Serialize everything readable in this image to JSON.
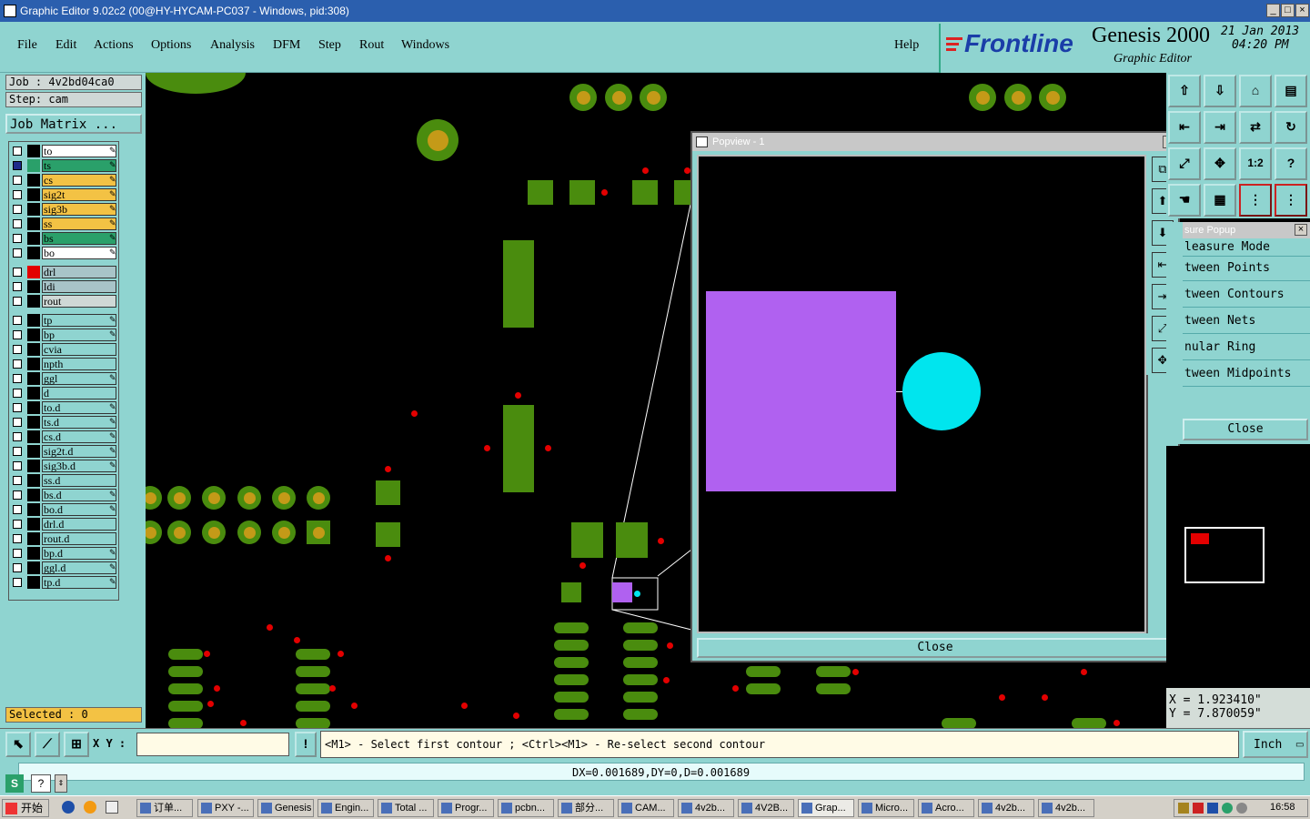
{
  "window": {
    "title": "Graphic Editor 9.02c2 (00@HY-HYCAM-PC037 - Windows, pid:308)"
  },
  "menu": [
    "File",
    "Edit",
    "Actions",
    "Options",
    "Analysis",
    "DFM",
    "Step",
    "Rout",
    "Windows"
  ],
  "help_label": "Help",
  "brand": {
    "logo": "Frontline",
    "product": "Genesis 2000",
    "subtitle": "Graphic Editor",
    "date": "21 Jan 2013",
    "time": "04:20 PM"
  },
  "job": {
    "job_label": "Job  :  4v2bd04ca0",
    "step_label": "Step:  cam",
    "matrix_button": "Job Matrix ..."
  },
  "layers": [
    {
      "name": "to",
      "color": "#ffffff"
    },
    {
      "name": "ts",
      "color": "#2aa06a"
    },
    {
      "name": "cs",
      "color": "#f3c244"
    },
    {
      "name": "sig2t",
      "color": "#f3c244"
    },
    {
      "name": "sig3b",
      "color": "#f3c244"
    },
    {
      "name": "ss",
      "color": "#f3c244"
    },
    {
      "name": "bs",
      "color": "#2aa06a"
    },
    {
      "name": "bo",
      "color": "#ffffff"
    },
    {
      "name": "drl",
      "color": "#a8c4c8"
    },
    {
      "name": "ldi",
      "color": "#a8c4c8"
    },
    {
      "name": "rout",
      "color": "#cfd8d6"
    },
    {
      "name": "tp",
      "color": "#8fd4d0"
    },
    {
      "name": "bp",
      "color": "#8fd4d0"
    },
    {
      "name": "cvia",
      "color": "#8fd4d0"
    },
    {
      "name": "npth",
      "color": "#8fd4d0"
    },
    {
      "name": "ggl",
      "color": "#8fd4d0"
    },
    {
      "name": "d",
      "color": "#8fd4d0"
    },
    {
      "name": "to.d",
      "color": "#8fd4d0"
    },
    {
      "name": "ts.d",
      "color": "#8fd4d0"
    },
    {
      "name": "cs.d",
      "color": "#8fd4d0"
    },
    {
      "name": "sig2t.d",
      "color": "#8fd4d0"
    },
    {
      "name": "sig3b.d",
      "color": "#8fd4d0"
    },
    {
      "name": "ss.d",
      "color": "#8fd4d0"
    },
    {
      "name": "bs.d",
      "color": "#8fd4d0"
    },
    {
      "name": "bo.d",
      "color": "#8fd4d0"
    },
    {
      "name": "drl.d",
      "color": "#8fd4d0"
    },
    {
      "name": "rout.d",
      "color": "#8fd4d0"
    },
    {
      "name": "bp.d",
      "color": "#8fd4d0"
    },
    {
      "name": "ggl.d",
      "color": "#8fd4d0"
    },
    {
      "name": "tp.d",
      "color": "#8fd4d0"
    }
  ],
  "selected_label": "Selected : 0",
  "popview": {
    "title": "Popview - 1",
    "close_label": "Close"
  },
  "measure": {
    "title": "sure Popup",
    "heading": "leasure Mode",
    "modes": [
      "tween Points",
      "tween Contours",
      "tween Nets",
      "nular Ring",
      "tween Midpoints"
    ],
    "close_label": "Close"
  },
  "coords": {
    "x": "X  =  1.923410\"",
    "y": "Y  =  7.870059\""
  },
  "cmd": {
    "xy_label": "X Y :",
    "xy_value": "",
    "prompt": "<M1> - Select first contour ; <Ctrl><M1> - Re-select second contour",
    "unit": "Inch"
  },
  "status": "DX=0.001689,DY=0,D=0.001689",
  "taskbar": {
    "start": "开始",
    "clock": "16:58",
    "tasks": [
      "订单...",
      "PXY -...",
      "Genesis",
      "Engin...",
      "Total ...",
      "Progr...",
      "pcbn...",
      "部分...",
      "CAM...",
      "4v2b...",
      "4V2B...",
      "Grap...",
      "Micro...",
      "Acro...",
      "4v2b...",
      "4v2b..."
    ]
  },
  "colors": {
    "panel": "#8fd4d0",
    "pad": "#4a8c0e",
    "drill": "#c49a18",
    "via": "#e30000",
    "selected_a": "#b061f0",
    "selected_b": "#00e5ee"
  }
}
